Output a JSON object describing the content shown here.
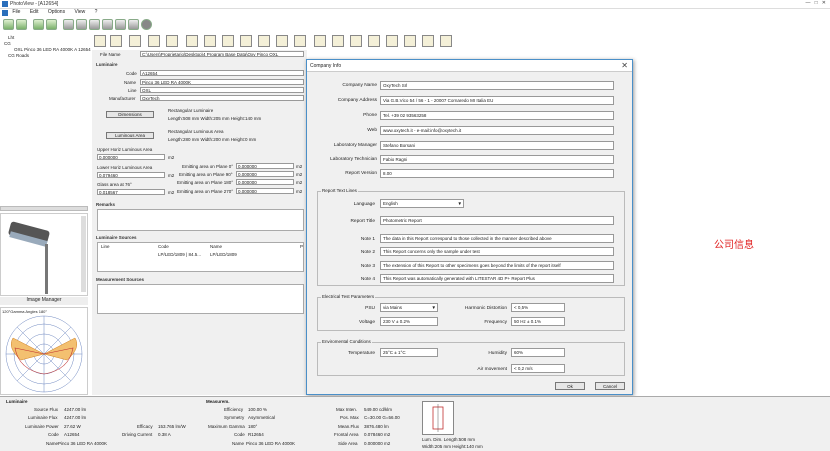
{
  "app": {
    "title": "PhotoView - [A12654]",
    "menu": [
      "File",
      "Edit",
      "Options",
      "View",
      "?"
    ]
  },
  "tree": [
    "Lht",
    "CG",
    "OXL Pinco 36 LED RA 4000K A 12654",
    "CG Roads"
  ],
  "image_manager": "Image Manager",
  "polar_label": "120°Gamma Angles 180°",
  "main": {
    "file_name_label": "File Name",
    "file_name": "C:\\Users\\Proprietario\\Desktop\\4 Program Base Data\\Oxy Pinco OXL",
    "luminaire_section": "Luminaire",
    "code_label": "Code",
    "code": "A12654",
    "name_label": "Name",
    "name": "Pinco 36 LED RA 4000K",
    "line_label": "Line",
    "line": "OXL",
    "manufacturer_label": "Manufacturer",
    "manufacturer": "OxyTech",
    "dimensions_btn": "Dimensions",
    "rect_lum1": "Rectangular Luminaire",
    "dim1": "Length:508 mm   Width:205 mm   Height:140 mm",
    "luminous_area_btn": "Luminous Area",
    "rect_lum2": "Rectangular Luminous Area",
    "dim2": "Length:280 mm   Width:200 mm   Height:0 mm",
    "upper_label": "Upper Horiz Luminous Area",
    "upper": "0.000000",
    "m2": "m2",
    "lower_label": "Lower Horiz Luminous Area",
    "lower": "0.079460",
    "glass_label": "Glass area at 76°",
    "glass": "0.018567",
    "plane0_label": "Emitting area on Plane 0°",
    "plane0": "0.000000",
    "plane90_label": "Emitting area on Plane 90°",
    "plane90": "0.000000",
    "plane180_label": "Emitting area on Plane 180°",
    "plane180": "0.000000",
    "plane270_label": "Emitting area on Plane 270°",
    "plane270": "0.000000",
    "remarks_label": "Remarks",
    "sources_label": "Luminaire Sources",
    "col_line": "Line",
    "col_code": "Code",
    "col_name": "Name",
    "col_p": "P",
    "row_code": "LP/LED/1809 | 84.5...",
    "row_name": "LP/LED/1809",
    "meas_sources": "Measurement Sources"
  },
  "dialog": {
    "title": "Company Info",
    "close": "✕",
    "company_name_label": "Company Name",
    "company_name": "OxyTech Srl",
    "company_address_label": "Company Address",
    "company_address": "Via G.B.Vico 54 / 56 - 1 - 20007 Cornaredo MI Italia EU",
    "phone_label": "Phone",
    "phone": "Tel. +39 02 93563258",
    "web_label": "Web",
    "web": "www.oxytech.it  -  e-mail:info@oxytech.it",
    "lab_manager_label": "Laboratory Manager",
    "lab_manager": "Stefano Borsani",
    "lab_tech_label": "Laboratory Technician",
    "lab_tech": "Fabio Ragni",
    "report_version_label": "Report Version",
    "report_version": "8.00",
    "report_text_lines": "Report Text Lines",
    "language_label": "Language",
    "language": "English",
    "report_title_label": "Report Title",
    "report_title": "Photometric Report",
    "note1_label": "Note 1",
    "note1": "The data in this Report correspond to those collected in the manner described above",
    "note2_label": "Note 2",
    "note2": "This Report concerns only the sample under test",
    "note3_label": "Note 3",
    "note3": "The extension of this Report to other specimens goes beyond the limits of the report itself",
    "note4_label": "Note 4",
    "note4": "This Report was automatically generated with LITESTAR 4D P+ Report Plus",
    "elec_params": "Electrical Test Parameters",
    "psu_label": "PSU",
    "psu": "via Mains",
    "harmonic_label": "Harmonic Distortion",
    "harmonic": "< 0,5%",
    "voltage_label": "Voltage",
    "voltage": "230 V ± 0.2%",
    "frequency_label": "Frequency",
    "frequency": "50 Hz ± 0.1%",
    "env_conditions": "Enviromental Conditions",
    "temp_label": "Temperature",
    "temp": "25°C ± 1°C",
    "humidity_label": "Humidity",
    "humidity": "60%",
    "air_label": "Air movement",
    "air": "< 0,2 m/s",
    "ok": "Ok",
    "cancel": "Cancel"
  },
  "annotation": "公司信息",
  "bottom": {
    "lum_title": "Luminaire",
    "source_flux_l": "Source Flux",
    "source_flux": "4247.00 lm",
    "lum_flux_l": "Luminaire Flux",
    "lum_flux": "4247.00 lm",
    "lum_power_l": "Luminaire Power",
    "lum_power": "27.62 W",
    "efficacy_l": "Efficacy",
    "efficacy": "153.765 lm/W",
    "code_l": "Code",
    "code": "A12654",
    "drive_l": "Driving Current",
    "drive": "0.38 A",
    "name_l": "Name",
    "name": "Pinco 36 LED RA 4000K",
    "meas_title": "Measurem.",
    "eff_l": "Efficiency",
    "eff": "100.00 %",
    "sym_l": "Symmetry",
    "sym": "Asymmetrical",
    "maxg_l": "Maximum Gamma",
    "maxg": "180°",
    "mcode_l": "Code",
    "mcode": "R12654",
    "mname_l": "Name",
    "mname": "Pinco 36 LED RA 4000K",
    "maxint_l": "Max Inten.",
    "maxint": "549.00 cd/klm",
    "posmax_l": "Pos. Max",
    "posmax": "C=30.00 G=56.00",
    "meanlum_l": "Mean.Flux",
    "meanlum": "3876.480 lm",
    "frontal_l": "Frontal Area",
    "frontal": "0.078460 m2",
    "side_l": "Side Area",
    "side": "0.000000 m2",
    "lumdim": "Lum. Dim.   Length:508 mm",
    "lumdim2": "Width:205 mm Height:140 mm"
  }
}
